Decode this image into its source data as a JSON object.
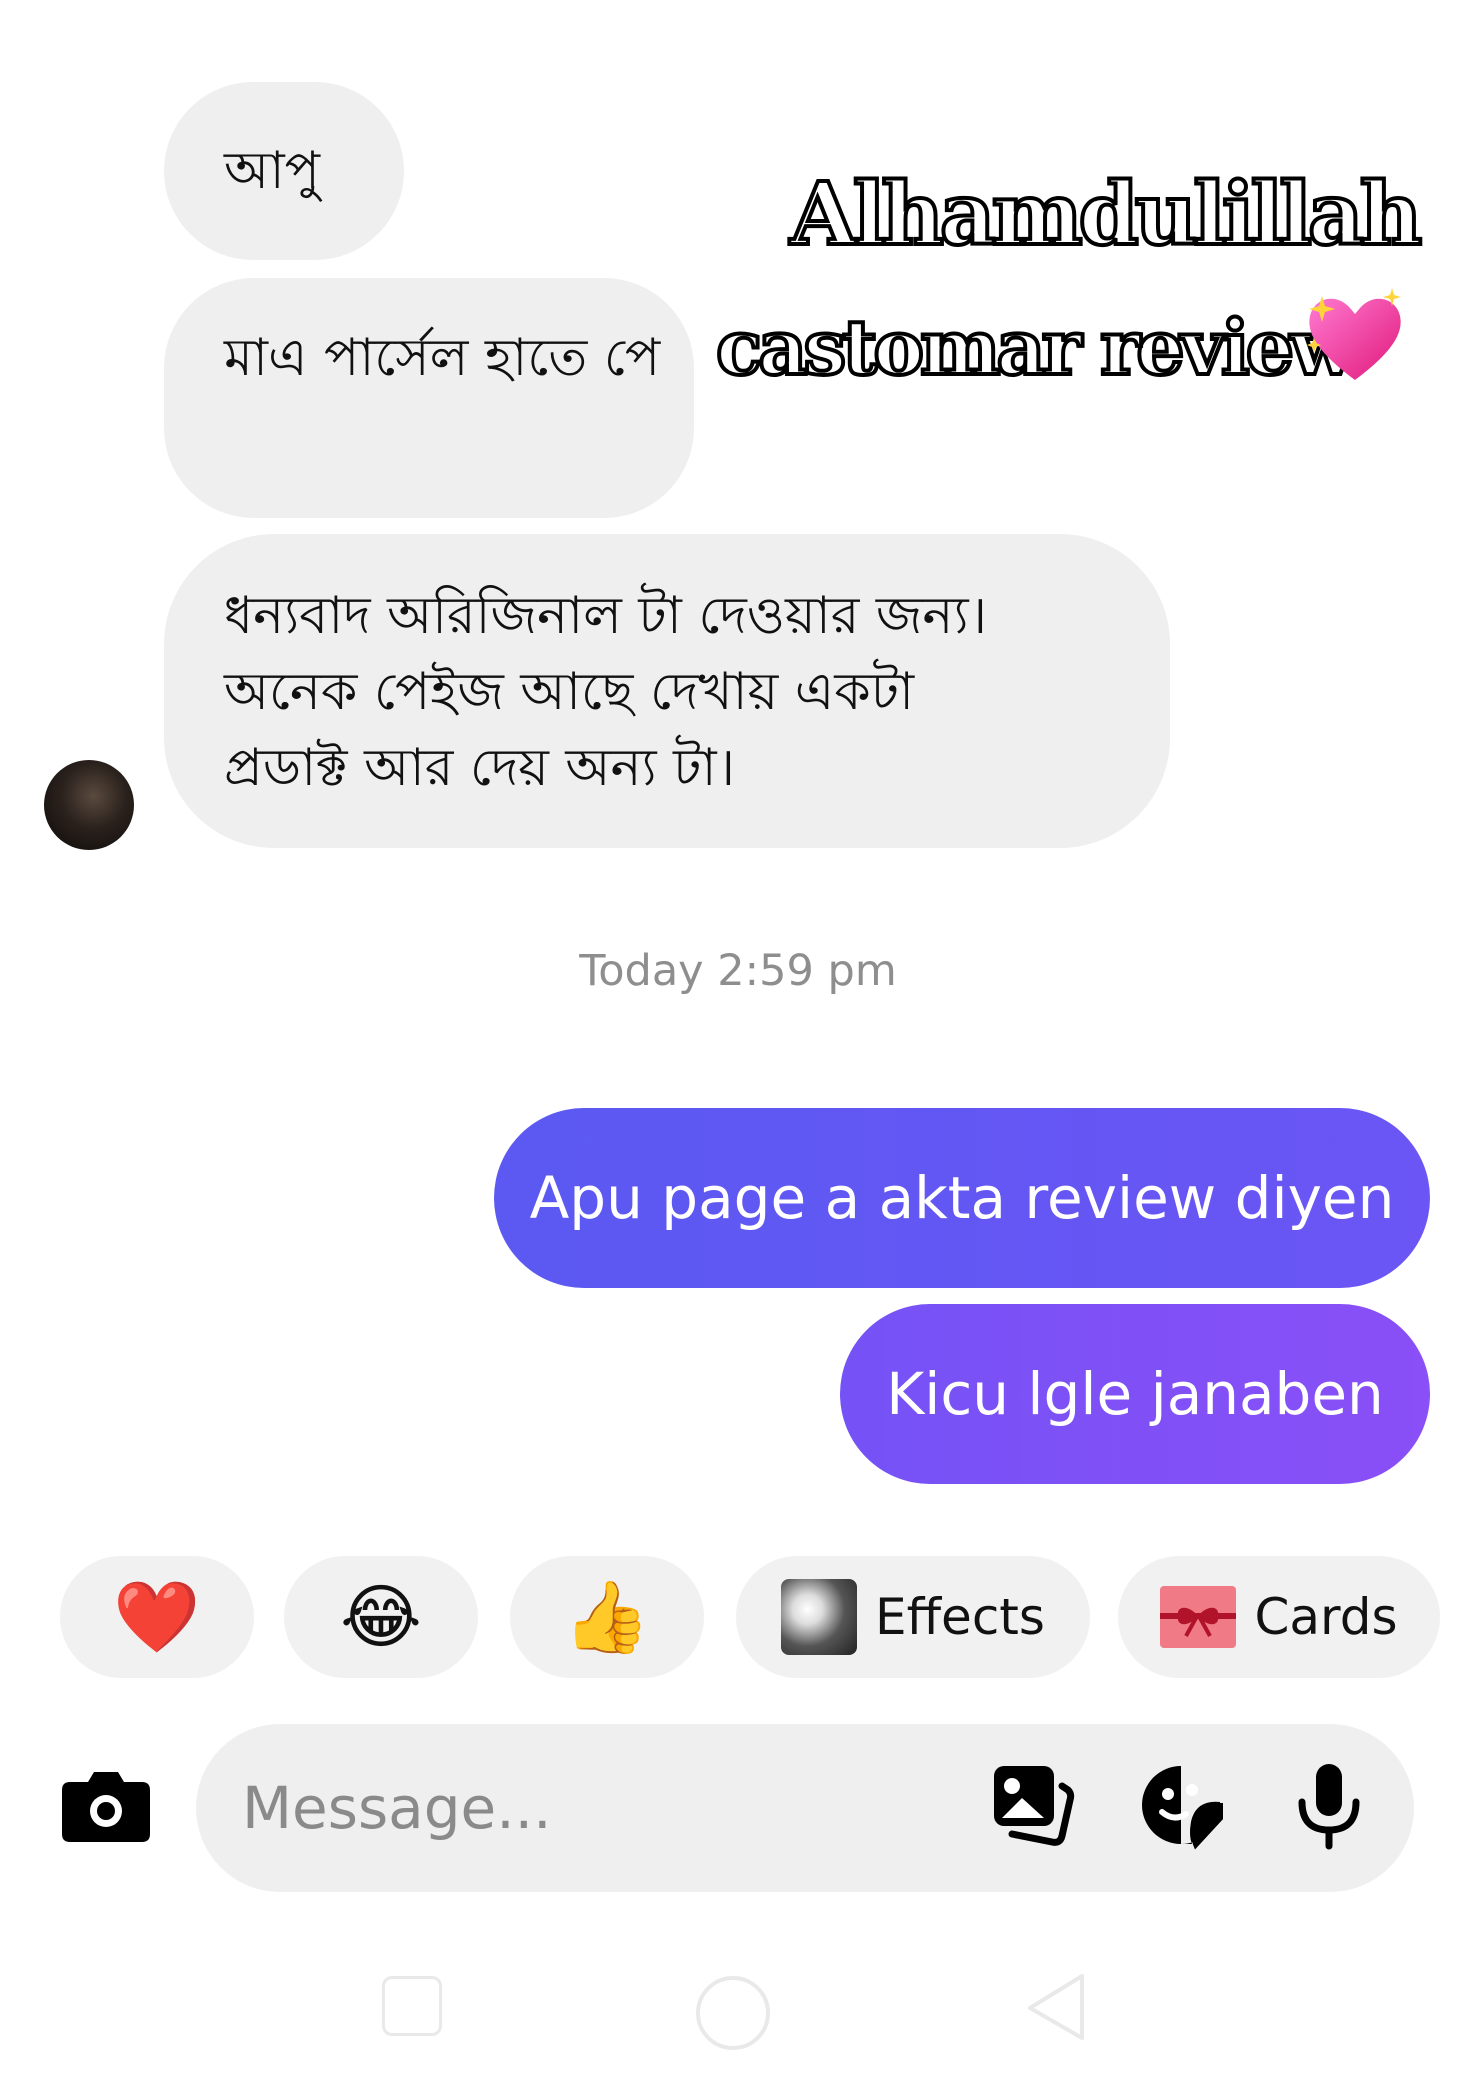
{
  "incoming": [
    {
      "text": "আপু"
    },
    {
      "text": "মাএ পার্সেল হাতে পে"
    },
    {
      "lines": [
        "ধন্যবাদ অরিজিনাল টা দেওয়ার জন্য।",
        "অনেক পেইজ আছে দেখায় একটা",
        "প্রডাক্ট আর দেয় অন্য টা।"
      ]
    }
  ],
  "overlay": {
    "line1": "Alhamdulillah",
    "line2": "castomar review",
    "emoji": "heart-with-sparkles"
  },
  "timestamp": "Today 2:59 pm",
  "outgoing": [
    {
      "text": "Apu page a akta review diyen"
    },
    {
      "text": "Kicu lgle janaben"
    }
  ],
  "quick_actions": {
    "heart": "❤️",
    "laugh": "😂",
    "thumbs_up": "👍",
    "effects_label": "Effects",
    "cards_label": "Cards"
  },
  "composer": {
    "placeholder": "Message...",
    "icons": [
      "camera-icon",
      "gallery-icon",
      "sticker-icon",
      "microphone-icon"
    ]
  },
  "colors": {
    "incoming_bubble": "#efefef",
    "outgoing_start": "#5b59f2",
    "outgoing_end": "#8a4ff7",
    "timestamp": "#8e8e8e"
  }
}
